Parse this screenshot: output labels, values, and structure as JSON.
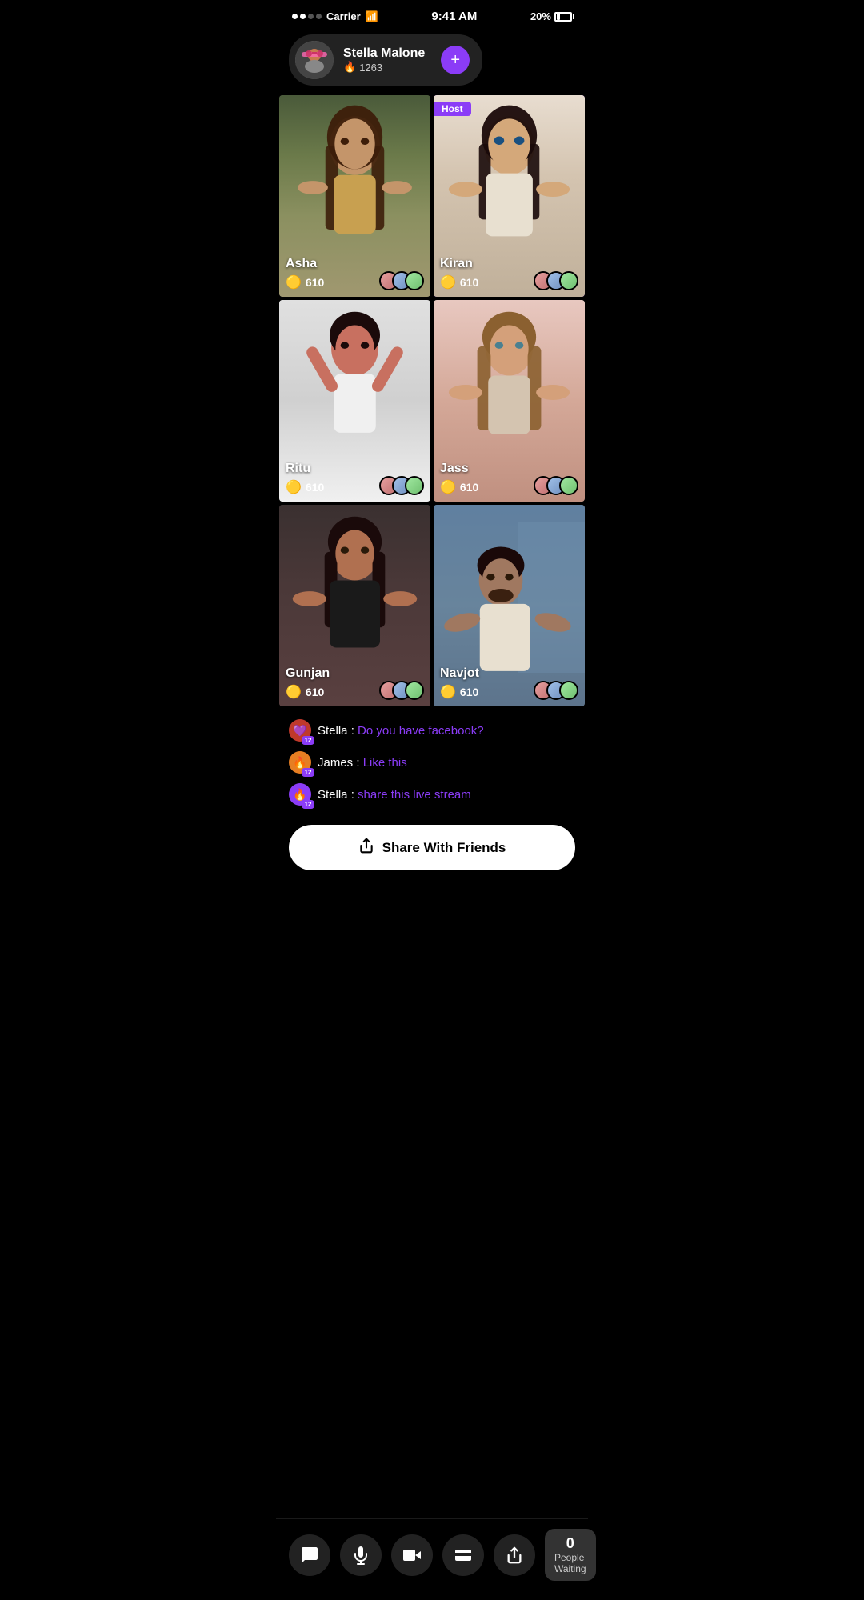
{
  "statusBar": {
    "carrier": "Carrier",
    "time": "9:41 AM",
    "battery": "20%"
  },
  "userCard": {
    "name": "Stella Malone",
    "score": "1263",
    "fireEmoji": "🔥",
    "addLabel": "+"
  },
  "streamers": [
    {
      "name": "Asha",
      "coins": "610",
      "isHost": false,
      "photoClass": "photo-asha",
      "skinTone": "#c4956a",
      "hairColor": "#3d1e0a"
    },
    {
      "name": "Kiran",
      "coins": "610",
      "isHost": true,
      "hostLabel": "Host",
      "photoClass": "photo-kiran",
      "skinTone": "#d4a87a",
      "hairColor": "#1a0a0a"
    },
    {
      "name": "Ritu",
      "coins": "610",
      "isHost": false,
      "photoClass": "photo-ritu",
      "skinTone": "#c87060",
      "hairColor": "#1a0a0a"
    },
    {
      "name": "Jass",
      "coins": "610",
      "isHost": false,
      "photoClass": "photo-jass",
      "skinTone": "#d4a07a",
      "hairColor": "#8b6030"
    },
    {
      "name": "Gunjan",
      "coins": "610",
      "isHost": false,
      "photoClass": "photo-gunjan",
      "skinTone": "#b07050",
      "hairColor": "#1a0a0a"
    },
    {
      "name": "Navjot",
      "coins": "610",
      "isHost": false,
      "photoClass": "photo-navjot",
      "skinTone": "#a07860",
      "hairColor": "#1a0808"
    }
  ],
  "coinSymbol": "🟡",
  "chat": {
    "messages": [
      {
        "user": "Stella",
        "message": "Do you have facebook?",
        "badgeEmoji": "💜",
        "badgeClass": "badge-heart",
        "level": "12"
      },
      {
        "user": "James",
        "message": "Like this",
        "badgeEmoji": "🔥",
        "badgeClass": "badge-fire",
        "level": "12"
      },
      {
        "user": "Stella",
        "message": "share this live stream",
        "badgeEmoji": "🔥",
        "badgeClass": "badge-purple",
        "level": "12"
      }
    ]
  },
  "shareButton": {
    "label": "Share With Friends",
    "icon": "↗"
  },
  "bottomNav": {
    "chatIcon": "💬",
    "micIcon": "🎤",
    "videoIcon": "🎥",
    "walletIcon": "👛",
    "shareIcon": "↗",
    "peopleWaiting": {
      "count": "0",
      "label": "People Waiting"
    }
  }
}
